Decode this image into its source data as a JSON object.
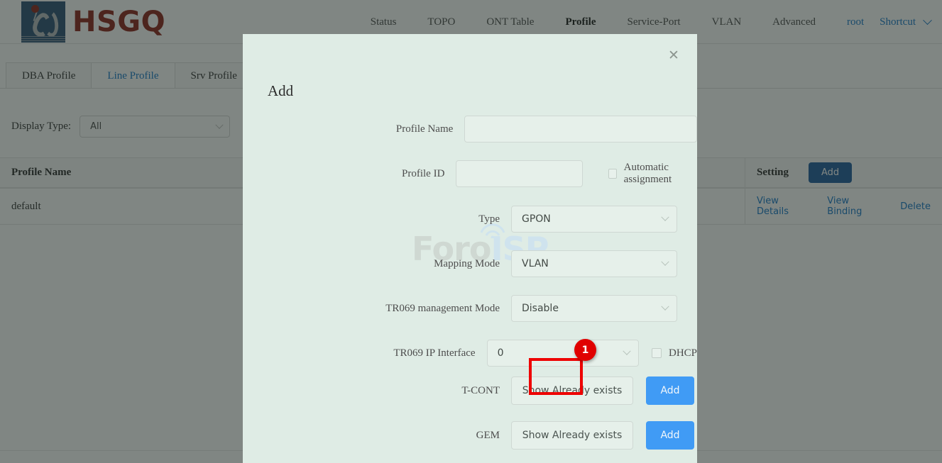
{
  "brand": {
    "name": "HSGQ",
    "logo_icon": "hsgq-logo-icon"
  },
  "nav": {
    "items": [
      {
        "label": "Status",
        "active": false
      },
      {
        "label": "TOPO",
        "active": false
      },
      {
        "label": "ONT Table",
        "active": false
      },
      {
        "label": "Profile",
        "active": true
      },
      {
        "label": "Service-Port",
        "active": false
      },
      {
        "label": "VLAN",
        "active": false
      },
      {
        "label": "Advanced",
        "active": false
      }
    ],
    "user": "root",
    "shortcut": "Shortcut"
  },
  "tabs": [
    {
      "label": "DBA Profile",
      "active": false
    },
    {
      "label": "Line Profile",
      "active": true
    },
    {
      "label": "Srv Profile",
      "active": false
    },
    {
      "label": "",
      "active": false
    }
  ],
  "filter": {
    "label": "Display Type:",
    "display_type_value": "All"
  },
  "table": {
    "headers": {
      "profile_name": "Profile Name",
      "middle": "",
      "setting": "Setting"
    },
    "add_button": "Add",
    "rows": [
      {
        "profile_name": "default",
        "middle": "",
        "actions": [
          "View Details",
          "View Binding",
          "Delete"
        ]
      }
    ]
  },
  "modal": {
    "title": "Add",
    "close_icon": "close-icon",
    "fields": {
      "profile_name": {
        "label": "Profile Name",
        "value": "",
        "placeholder": ""
      },
      "profile_id": {
        "label": "Profile ID",
        "value": "",
        "placeholder": ""
      },
      "automatic_assignment": {
        "label": "Automatic assignment",
        "checked": false
      },
      "type": {
        "label": "Type",
        "value": "GPON"
      },
      "mapping_mode": {
        "label": "Mapping Mode",
        "value": "VLAN"
      },
      "tr069_management_mode": {
        "label": "TR069 management Mode",
        "value": "Disable"
      },
      "tr069_ip_interface": {
        "label": "TR069 IP Interface",
        "value": "0"
      },
      "dhcp": {
        "label": "DHCP",
        "checked": false
      },
      "tcont": {
        "label": "T-CONT",
        "show_button": "Show Already exists",
        "add_button": "Add"
      },
      "gem": {
        "label": "GEM",
        "show_button": "Show Already exists",
        "add_button": "Add"
      }
    }
  },
  "annotation": {
    "badge": "1",
    "color": "#ee0000"
  },
  "watermark": {
    "part1": "Foro",
    "part2": "ISP"
  },
  "colors": {
    "brand_red": "#8c2219",
    "logo_blue": "#2d5175",
    "link_blue": "#1677c8",
    "button_blue": "#409bf5",
    "table_button_blue": "#1f5c9e",
    "modal_bg": "#dfece5",
    "annotation_red": "#ee0000"
  }
}
